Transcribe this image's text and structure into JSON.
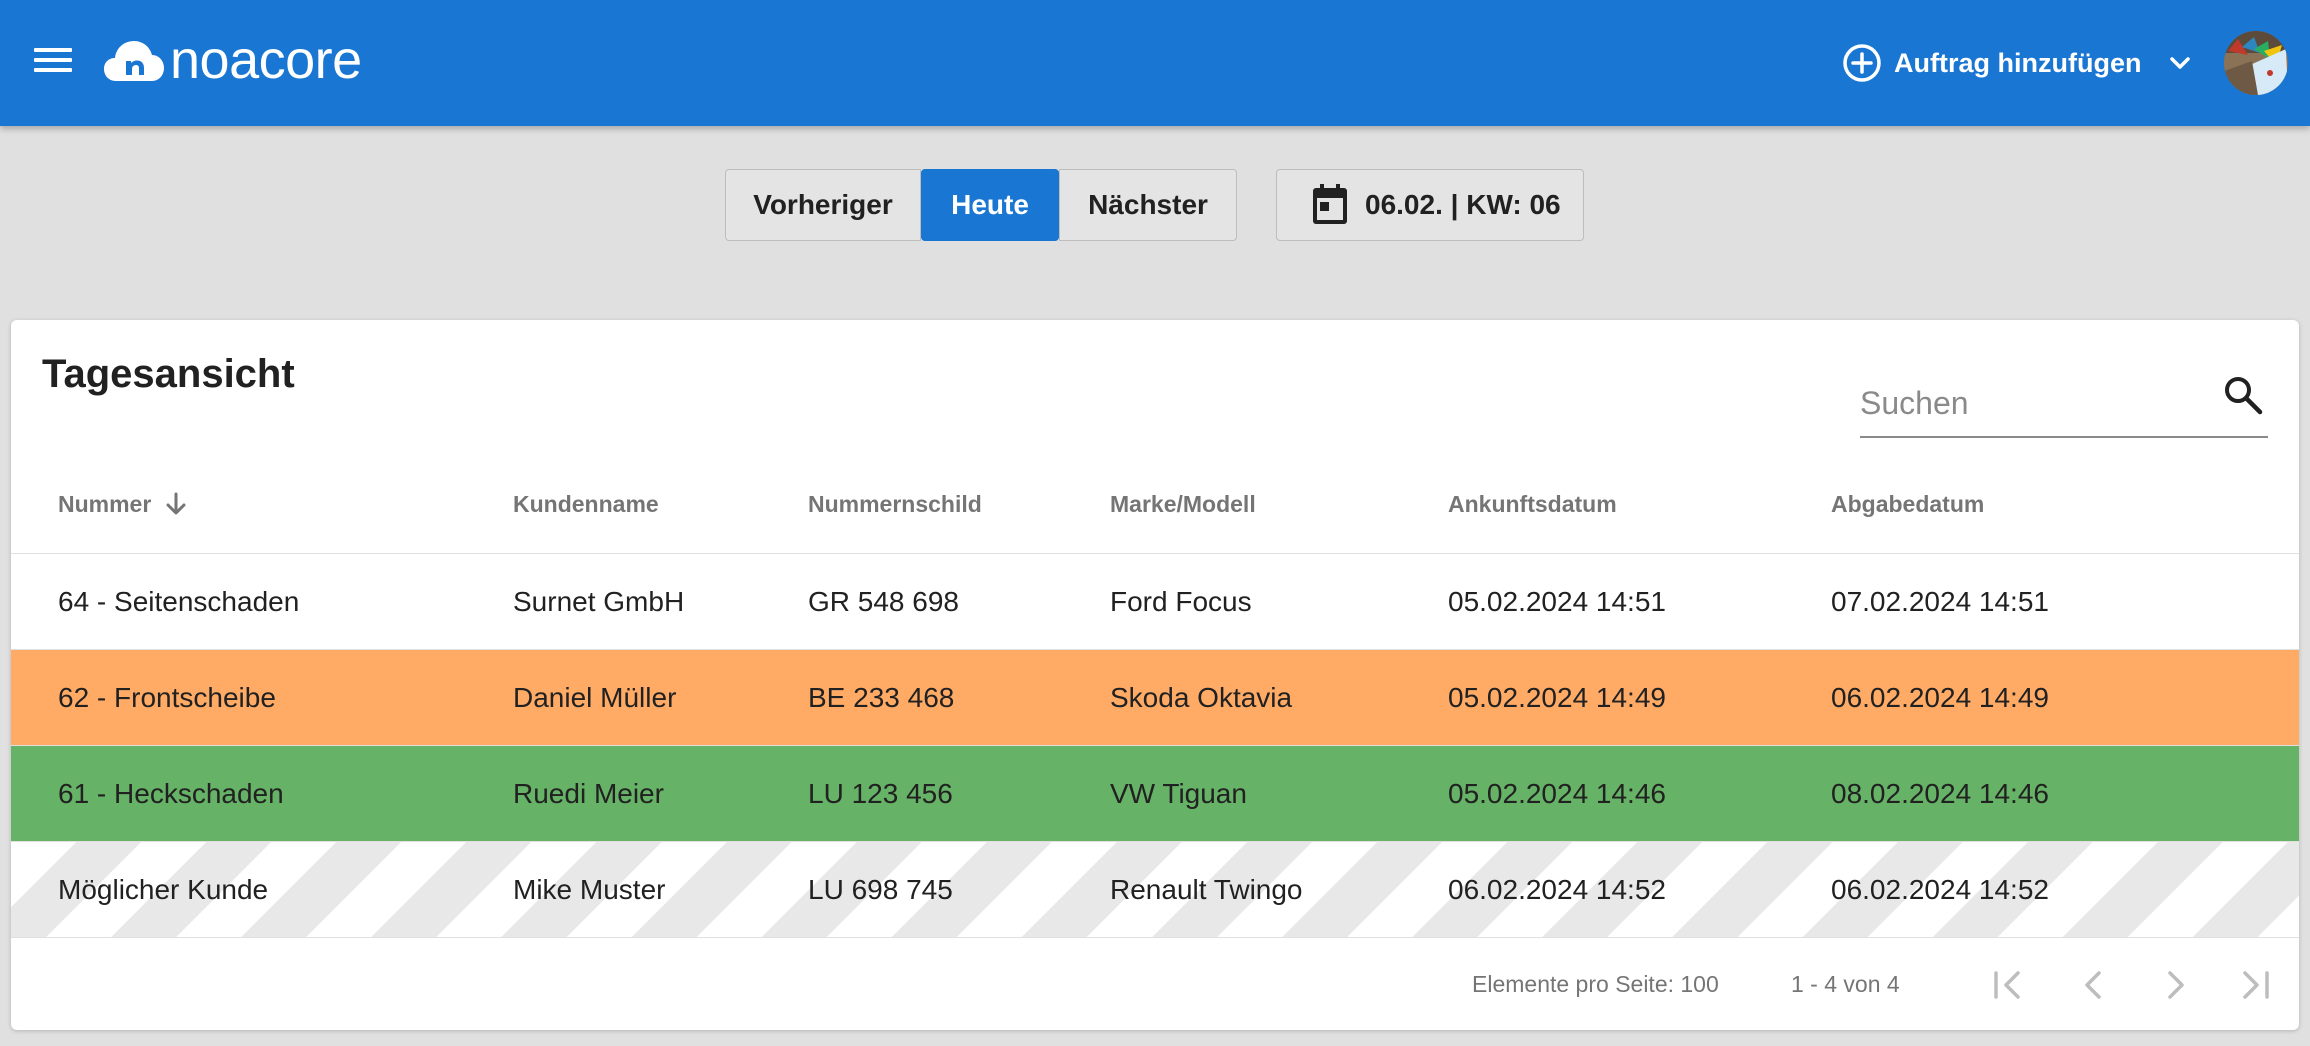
{
  "app": {
    "logo_text": "noacore",
    "menu_icon": "menu-icon",
    "brand_color": "#1976d2"
  },
  "header": {
    "add_order_label": "Auftrag hinzufügen",
    "add_icon": "add-circle-icon",
    "dropdown_icon": "chevron-down-icon"
  },
  "navigation": {
    "previous_label": "Vorheriger",
    "today_label": "Heute",
    "next_label": "Nächster",
    "date_label": "06.02. | KW: 06",
    "date_icon": "calendar-icon"
  },
  "card": {
    "title": "Tagesansicht",
    "search_placeholder": "Suchen",
    "search_icon": "search-icon"
  },
  "table": {
    "columns": [
      "Nummer",
      "Kundenname",
      "Nummernschild",
      "Marke/Modell",
      "Ankunftsdatum",
      "Abgabedatum"
    ],
    "sort_column": "Nummer",
    "sort_direction": "descending",
    "rows": [
      {
        "nummer": "64 - Seitenschaden",
        "kunde": "Surnet GmbH",
        "schild": "GR 548 698",
        "modell": "Ford Focus",
        "ankunft": "05.02.2024 14:51",
        "abgabe": "07.02.2024 14:51",
        "status_color": "#ffffff"
      },
      {
        "nummer": "62 - Frontscheibe",
        "kunde": "Daniel Müller",
        "schild": "BE 233 468",
        "modell": "Skoda Oktavia",
        "ankunft": "05.02.2024 14:49",
        "abgabe": "06.02.2024 14:49",
        "status_color": "#ffab66"
      },
      {
        "nummer": "61 - Heckschaden",
        "kunde": "Ruedi Meier",
        "schild": "LU 123 456",
        "modell": "VW Tiguan",
        "ankunft": "05.02.2024 14:46",
        "abgabe": "08.02.2024 14:46",
        "status_color": "#66b266"
      },
      {
        "nummer": "Möglicher Kunde",
        "kunde": "Mike Muster",
        "schild": "LU 698 745",
        "modell": "Renault Twingo",
        "ankunft": "06.02.2024 14:52",
        "abgabe": "06.02.2024 14:52",
        "status_color": "striped"
      }
    ]
  },
  "paginator": {
    "page_size_label": "Elemente pro Seite: 100",
    "range_label": "1 - 4 von 4",
    "icons": [
      "first-page-icon",
      "previous-page-icon",
      "next-page-icon",
      "last-page-icon"
    ]
  }
}
